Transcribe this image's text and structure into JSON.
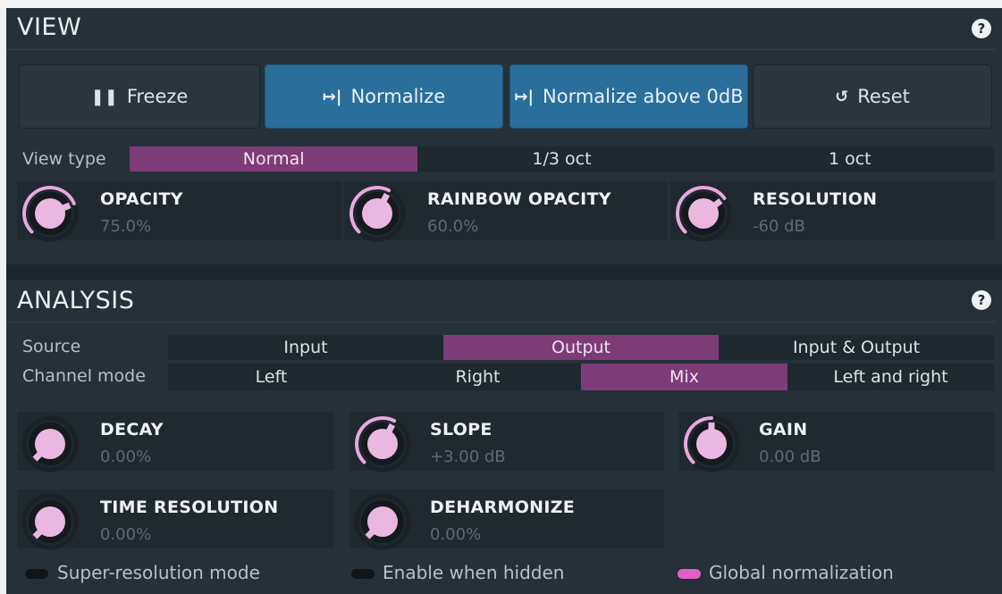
{
  "view": {
    "title": "VIEW",
    "help": "?",
    "buttons": [
      {
        "label": "Freeze",
        "icon": "pause-icon",
        "glyph": "❚❚"
      },
      {
        "label": "Normalize",
        "icon": "normalize-icon",
        "glyph": "↦|"
      },
      {
        "label": "Normalize above 0dB",
        "icon": "normalize-icon",
        "glyph": "↦|"
      },
      {
        "label": "Reset",
        "icon": "reset-icon",
        "glyph": "↺"
      }
    ],
    "view_type": {
      "label": "View type",
      "options": [
        "Normal",
        "1/3 oct",
        "1 oct"
      ],
      "selected": "Normal"
    },
    "knobs": [
      {
        "name": "OPACITY",
        "value": "75.0%",
        "fraction": 0.75
      },
      {
        "name": "RAINBOW OPACITY",
        "value": "60.0%",
        "fraction": 0.6
      },
      {
        "name": "RESOLUTION",
        "value": "-60 dB",
        "fraction": 0.7
      }
    ]
  },
  "analysis": {
    "title": "ANALYSIS",
    "help": "?",
    "source": {
      "label": "Source",
      "options": [
        "Input",
        "Output",
        "Input & Output"
      ],
      "selected": "Output"
    },
    "channel_mode": {
      "label": "Channel mode",
      "options": [
        "Left",
        "Right",
        "Mix",
        "Left and right"
      ],
      "selected": "Mix"
    },
    "knobs": [
      {
        "name": "DECAY",
        "value": "0.00%",
        "fraction": 0.0
      },
      {
        "name": "SLOPE",
        "value": "+3.00 dB",
        "fraction": 0.6
      },
      {
        "name": "GAIN",
        "value": "0.00 dB",
        "fraction": 0.5
      },
      {
        "name": "TIME RESOLUTION",
        "value": "0.00%",
        "fraction": 0.0
      },
      {
        "name": "DEHARMONIZE",
        "value": "0.00%",
        "fraction": 0.0
      }
    ],
    "toggles": [
      {
        "label": "Super-resolution mode",
        "on": false
      },
      {
        "label": "Enable when hidden",
        "on": false
      },
      {
        "label": "Global normalization",
        "on": true
      }
    ]
  },
  "colors": {
    "accent_pink": "#e8a8dc",
    "selected_segment": "#7d3b78",
    "button_blue": "#2a6e9b"
  }
}
